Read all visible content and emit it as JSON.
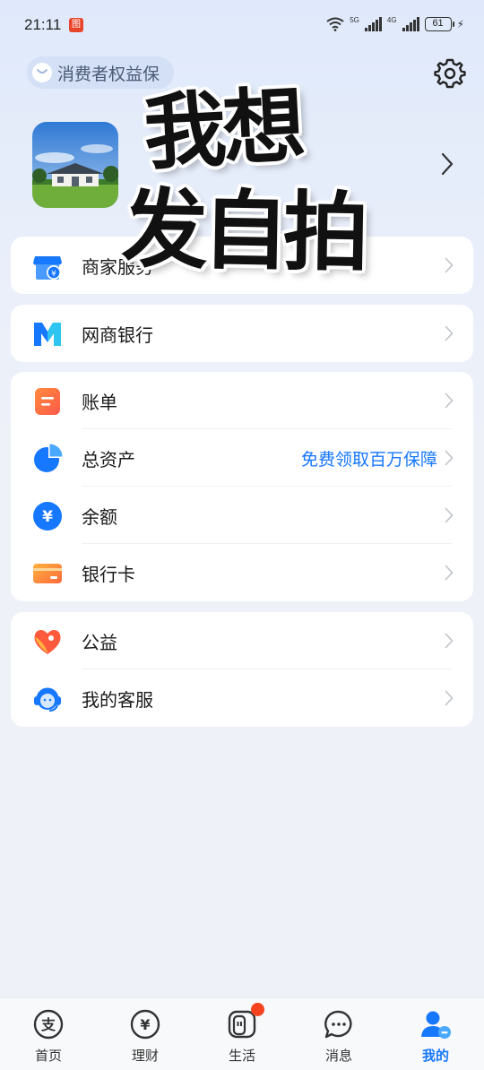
{
  "status_bar": {
    "time": "21:11",
    "app_badge": "图",
    "net1": "5G",
    "net2": "4G",
    "battery": "61"
  },
  "header": {
    "consumer_rights": "消费者权益保"
  },
  "sticker": {
    "line1": "我想",
    "line2": "发自拍"
  },
  "cards": [
    {
      "rows": [
        {
          "label": "商家服务",
          "icon": "merchant-store-icon"
        }
      ]
    },
    {
      "rows": [
        {
          "label": "网商银行",
          "icon": "mybank-icon"
        }
      ]
    },
    {
      "rows": [
        {
          "label": "账单",
          "icon": "bill-icon"
        },
        {
          "label": "总资产",
          "icon": "assets-pie-icon",
          "extra": "免费领取百万保障"
        },
        {
          "label": "余额",
          "icon": "balance-yuan-icon"
        },
        {
          "label": "银行卡",
          "icon": "bank-card-icon"
        }
      ]
    },
    {
      "rows": [
        {
          "label": "公益",
          "icon": "charity-heart-icon"
        },
        {
          "label": "我的客服",
          "icon": "customer-service-icon"
        }
      ]
    }
  ],
  "bottom_nav": [
    {
      "label": "首页",
      "icon": "alipay-home-icon"
    },
    {
      "label": "理财",
      "icon": "wealth-yuan-icon"
    },
    {
      "label": "生活",
      "icon": "life-icon"
    },
    {
      "label": "消息",
      "icon": "message-icon"
    },
    {
      "label": "我的",
      "icon": "me-icon",
      "active": true
    }
  ],
  "colors": {
    "accent": "#1677ff",
    "badge_red": "#f5431f"
  }
}
